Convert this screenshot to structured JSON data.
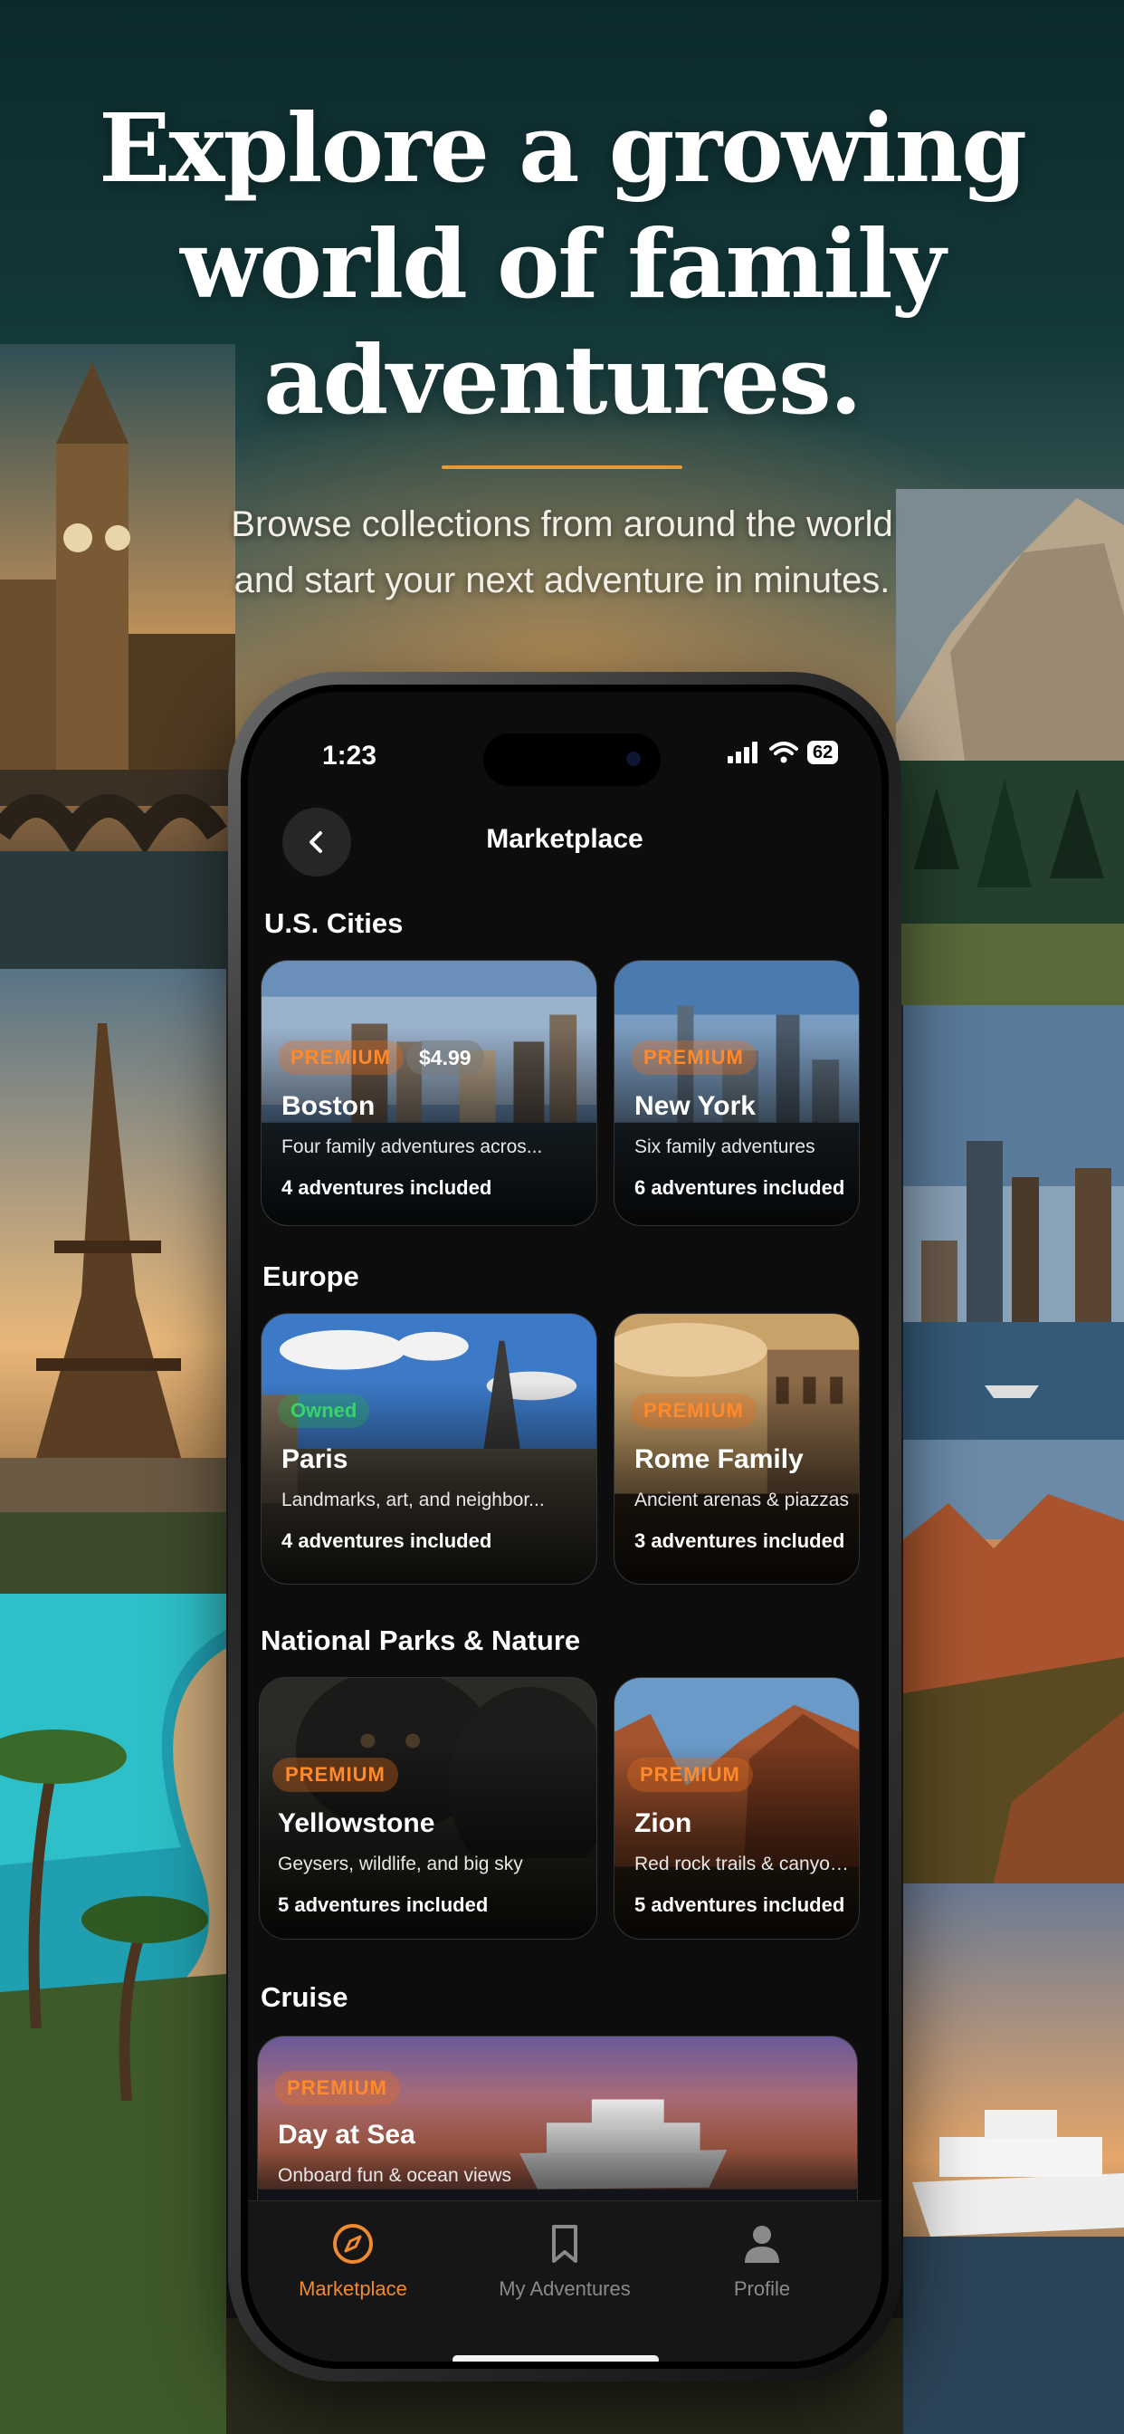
{
  "headline": {
    "line1": "Explore a growing",
    "line2": "world of family",
    "line3": "adventures."
  },
  "subhead": {
    "line1": "Browse collections from around the world",
    "line2": "and start your next adventure in minutes."
  },
  "status_bar": {
    "time": "1:23",
    "battery": "62"
  },
  "nav": {
    "title": "Marketplace"
  },
  "sections": [
    {
      "title": "U.S. Cities",
      "cards": [
        {
          "badge": "PREMIUM",
          "price": "$4.99",
          "title": "Boston",
          "description": "Four family adventures acros...",
          "count": "4 adventures included"
        },
        {
          "badge": "PREMIUM",
          "title": "New York",
          "description": "Six family adventures",
          "count": "6 adventures included"
        }
      ]
    },
    {
      "title": "Europe",
      "cards": [
        {
          "badge": "Owned",
          "title": "Paris",
          "description": "Landmarks, art, and neighbor...",
          "count": "4 adventures included"
        },
        {
          "badge": "PREMIUM",
          "title": "Rome Family",
          "description": "Ancient arenas & piazzas",
          "count": "3 adventures included"
        }
      ]
    },
    {
      "title": "National Parks & Nature",
      "cards": [
        {
          "badge": "PREMIUM",
          "title": "Yellowstone",
          "description": "Geysers, wildlife, and big sky",
          "count": "5 adventures included"
        },
        {
          "badge": "PREMIUM",
          "title": "Zion",
          "description": "Red rock trails & canyons",
          "count": "5 adventures included"
        }
      ]
    },
    {
      "title": "Cruise",
      "cards": [
        {
          "badge": "PREMIUM",
          "title": "Day at Sea",
          "description": "Onboard fun & ocean views"
        }
      ]
    }
  ],
  "tabs": [
    {
      "label": "Marketplace",
      "icon": "compass-icon",
      "active": true
    },
    {
      "label": "My Adventures",
      "icon": "bookmark-icon",
      "active": false
    },
    {
      "label": "Profile",
      "icon": "person-icon",
      "active": false
    }
  ],
  "colors": {
    "accent": "#f08a30",
    "premium_badge": "#ff8a2b",
    "owned_badge": "#38d36a",
    "headline_rule": "#e59a3a",
    "screen_background": "#0d0d0d"
  }
}
